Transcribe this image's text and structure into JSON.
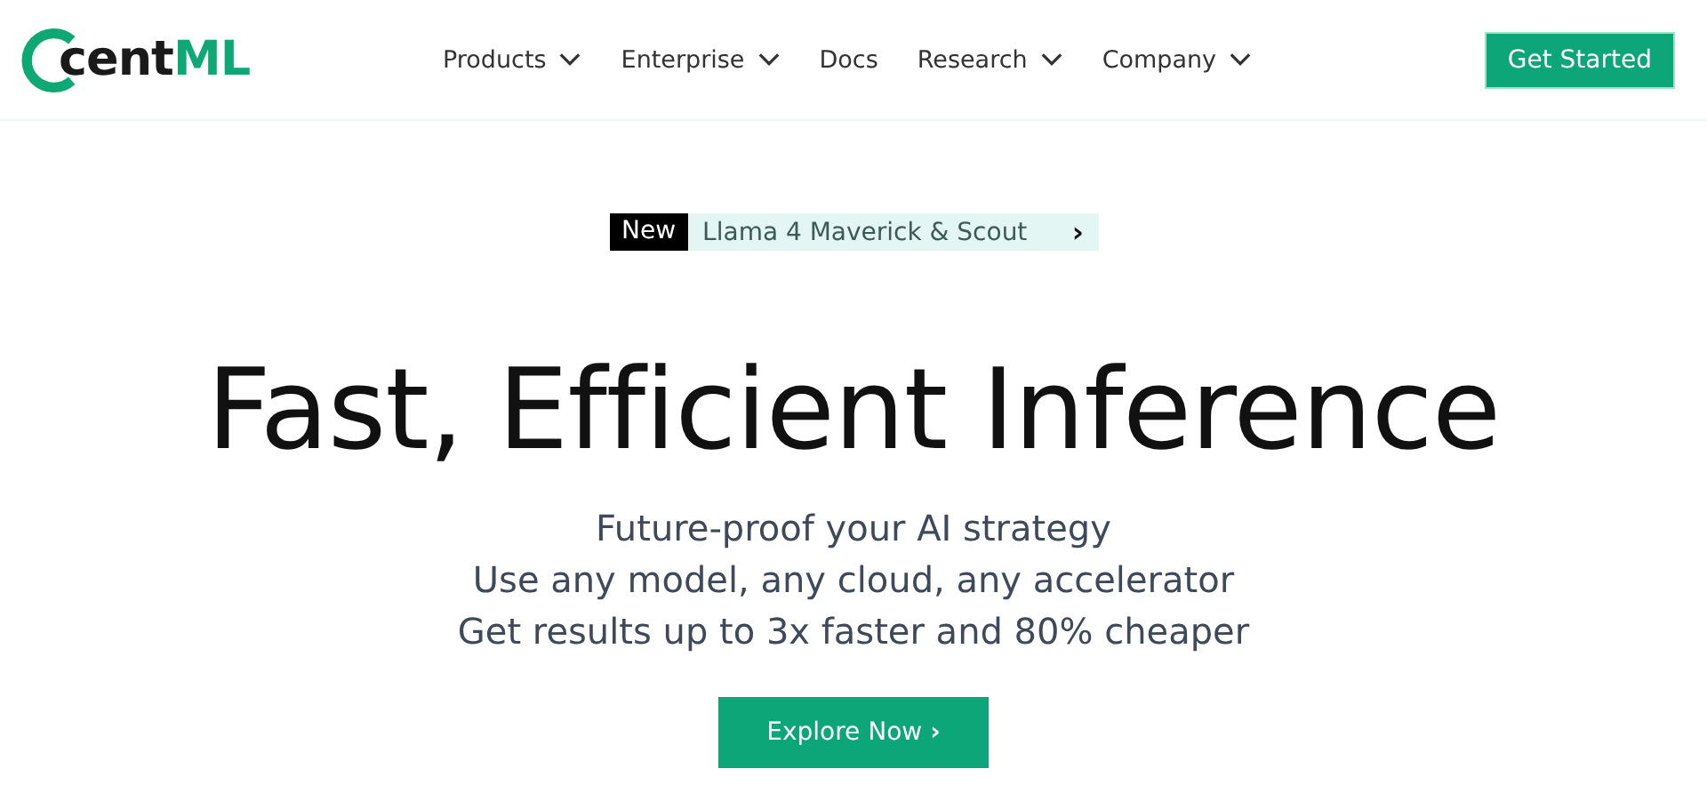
{
  "header": {
    "logo": {
      "dark": "cent",
      "accent": "ML"
    },
    "nav": [
      {
        "label": "Products",
        "has_menu": true
      },
      {
        "label": "Enterprise",
        "has_menu": true
      },
      {
        "label": "Docs",
        "has_menu": false
      },
      {
        "label": "Research",
        "has_menu": true
      },
      {
        "label": "Company",
        "has_menu": true
      }
    ],
    "cta": "Get Started"
  },
  "announcement": {
    "tag": "New",
    "text": "Llama 4 Maverick & Scout",
    "arrow": "›"
  },
  "hero": {
    "title": "Fast, Efficient Inference",
    "subtitle_lines": [
      "Future-proof your AI strategy",
      "Use any model, any cloud, any accelerator",
      "Get results up to 3x faster and 80% cheaper"
    ],
    "button": {
      "label": "Explore Now",
      "arrow": "›"
    }
  }
}
